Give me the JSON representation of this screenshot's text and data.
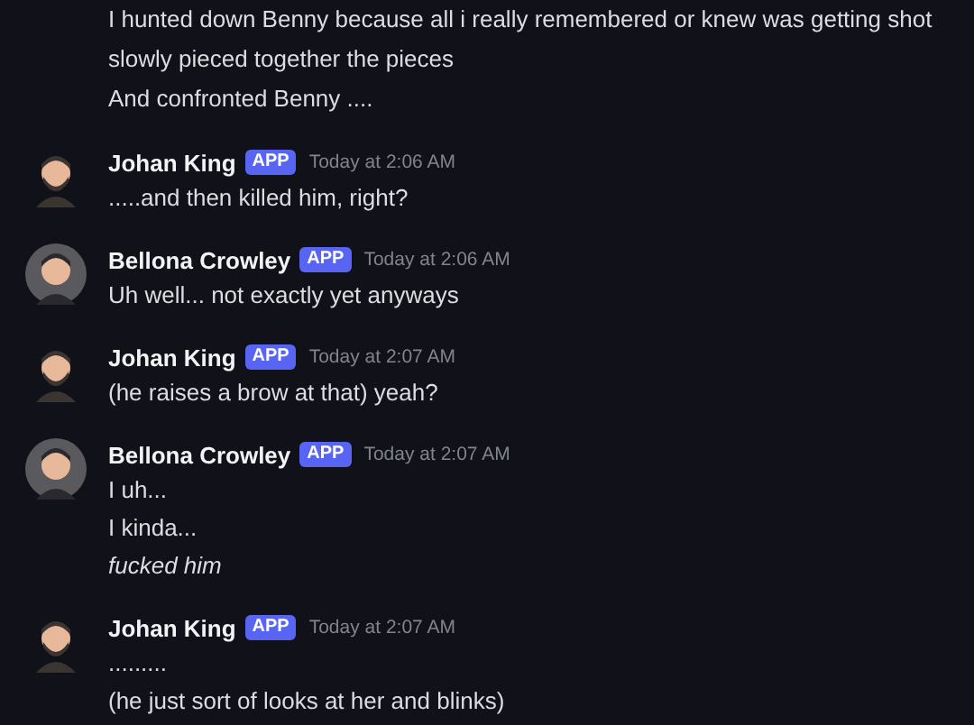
{
  "messages": [
    {
      "kind": "continuation",
      "lines": [
        {
          "kind": "plain",
          "text": "I hunted down Benny because all i really remembered or knew was getting shot"
        },
        {
          "kind": "plain",
          "text": "slowly pieced together the pieces"
        },
        {
          "kind": "plain",
          "text": "And confronted Benny ...."
        }
      ]
    },
    {
      "kind": "man",
      "author": "Johan King",
      "badge": "APP",
      "time": "Today at 2:06 AM",
      "lines": [
        {
          "kind": "plain",
          "text": ".....and then killed him, right?"
        }
      ]
    },
    {
      "kind": "woman",
      "author": "Bellona Crowley",
      "badge": "APP",
      "time": "Today at 2:06 AM",
      "lines": [
        {
          "kind": "plain",
          "text": "Uh well... not exactly yet anyways"
        }
      ]
    },
    {
      "kind": "man",
      "author": "Johan King",
      "badge": "APP",
      "time": "Today at 2:07 AM",
      "lines": [
        {
          "kind": "plain",
          "text": "(he raises a brow at that) yeah?"
        }
      ]
    },
    {
      "kind": "woman",
      "author": "Bellona Crowley",
      "badge": "APP",
      "time": "Today at 2:07 AM",
      "lines": [
        {
          "kind": "plain",
          "text": "I uh..."
        },
        {
          "kind": "plain",
          "text": "I kinda..."
        },
        {
          "kind": "italic",
          "text": "fucked him"
        }
      ]
    },
    {
      "kind": "man",
      "author": "Johan King",
      "badge": "APP",
      "time": "Today at 2:07 AM",
      "lines": [
        {
          "kind": "plain",
          "text": "........."
        },
        {
          "kind": "plain",
          "text": "(he just sort of looks at her and blinks)"
        }
      ]
    }
  ]
}
